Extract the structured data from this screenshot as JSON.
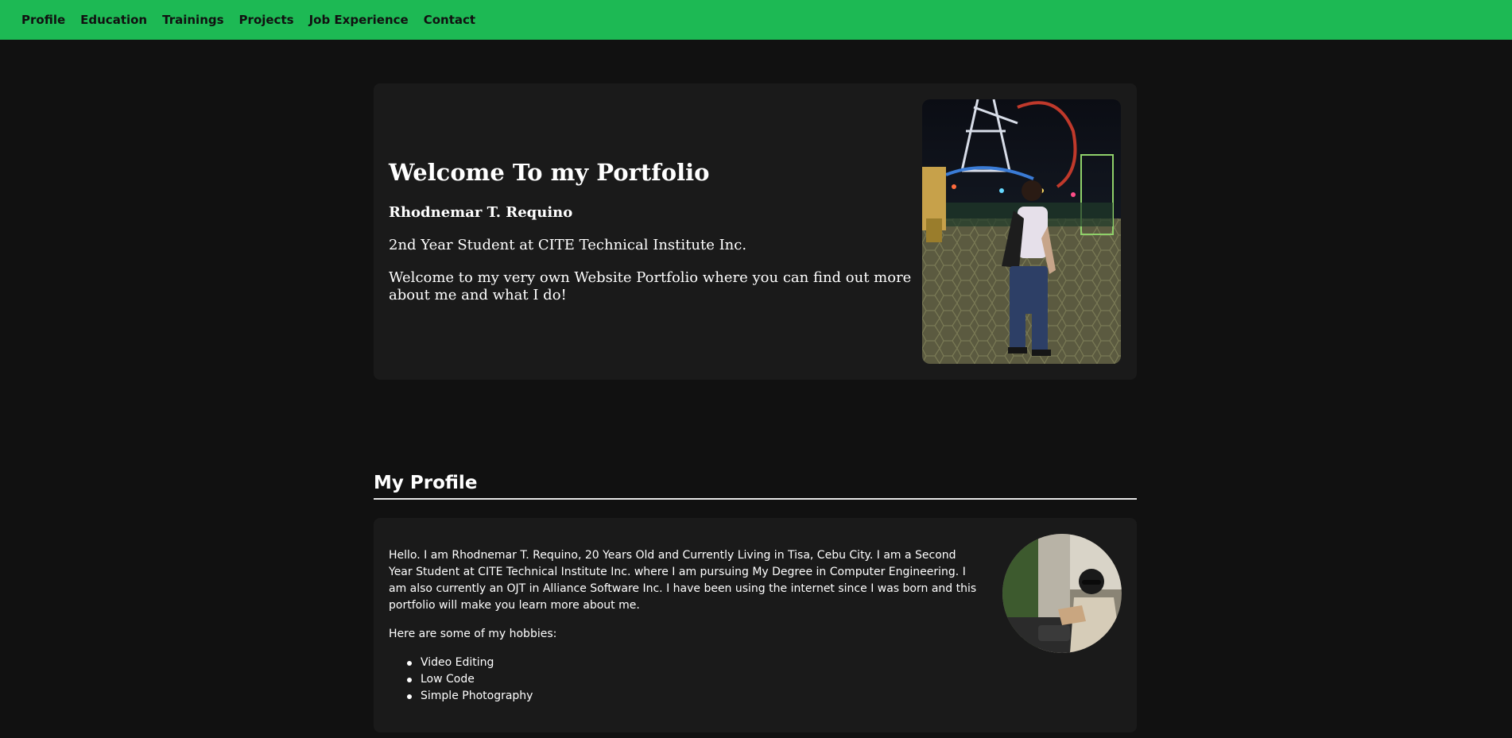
{
  "nav": {
    "items": [
      {
        "label": "Profile"
      },
      {
        "label": "Education"
      },
      {
        "label": "Trainings"
      },
      {
        "label": "Projects"
      },
      {
        "label": "Job Experience"
      },
      {
        "label": "Contact"
      }
    ]
  },
  "hero": {
    "title": "Welcome To my Portfolio",
    "name": "Rhodnemar T. Requino",
    "role": "2nd Year Student at CITE Technical Institute Inc.",
    "description": "Welcome to my very own Website Portfolio where you can find out more about me and what I do!",
    "photo_icon": "portrait-photo-icon"
  },
  "profile": {
    "title": "My Profile",
    "intro": "Hello. I am Rhodnemar T. Requino, 20 Years Old and Currently Living in Tisa, Cebu City. I am a Second Year Student at CITE Technical Institute Inc. where I am pursuing My Degree in Computer Engineering. I am also currently an OJT in Alliance Software Inc. I have been using the internet since I was born and this portfolio will make you learn more about me.",
    "hobbies_heading": "Here are some of my hobbies:",
    "hobbies": [
      {
        "label": "Video Editing"
      },
      {
        "label": "Low Code"
      },
      {
        "label": "Simple Photography"
      }
    ],
    "photo_icon": "avatar-photo-icon"
  },
  "colors": {
    "accent": "#1db954",
    "background": "#111111",
    "card": "#1a1a1a"
  }
}
